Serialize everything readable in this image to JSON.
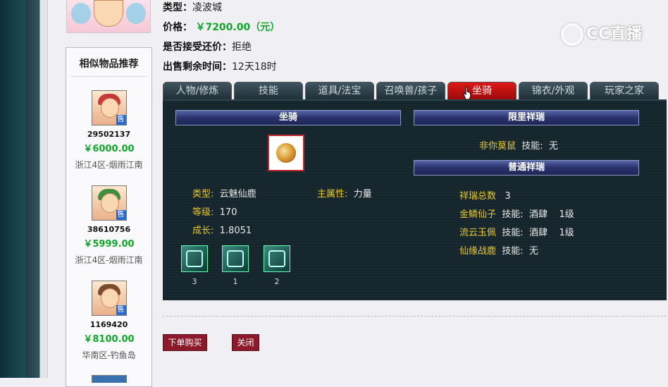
{
  "item": {
    "type_label": "类型：",
    "type_value": "凌波城",
    "price_label": "价格：",
    "price_value": "￥7200.00（元）",
    "bargain_label": "是否接受还价：",
    "bargain_value": "拒绝",
    "remaining_label": "出售剩余时间：",
    "remaining_value": "12天18时"
  },
  "watermark": "CC直播",
  "sidebar": {
    "title": "相似物品推荐",
    "sale_badge": "售",
    "items": [
      {
        "id": "29502137",
        "price": "￥6000.00",
        "server": "浙江4区-烟雨江南",
        "hair_color": "#c83a3a"
      },
      {
        "id": "38610756",
        "price": "￥5999.00",
        "server": "浙江4区-烟雨江南",
        "hair_color": "#3e8f3e"
      },
      {
        "id": "1169420",
        "price": "￥8100.00",
        "server": "华南区-钓鱼岛",
        "hair_color": "#7a4b2a"
      }
    ]
  },
  "tabs": [
    {
      "label": "人物/修炼",
      "active": false
    },
    {
      "label": "技能",
      "active": false
    },
    {
      "label": "道具/法宝",
      "active": false
    },
    {
      "label": "召唤兽/孩子",
      "active": false
    },
    {
      "label": "坐骑",
      "active": true
    },
    {
      "label": "锦衣/外观",
      "active": false
    },
    {
      "label": "玩家之家",
      "active": false
    }
  ],
  "mount": {
    "header": "坐骑",
    "type_label": "类型:",
    "type_value": "云魅仙鹿",
    "main_attr_label": "主属性:",
    "main_attr_value": "力量",
    "level_label": "等级:",
    "level_value": "170",
    "growth_label": "成长:",
    "growth_value": "1.8051",
    "skills": [
      "3",
      "1",
      "2"
    ]
  },
  "limited": {
    "header": "限里祥瑞",
    "name": "非你莫鼠",
    "skill_label": "技能:",
    "skill_value": "无"
  },
  "normal": {
    "header": "普通祥瑞",
    "total_label": "祥瑞总数",
    "total_value": "3",
    "items": [
      {
        "name": "金鳞仙子",
        "skill_label": "技能:",
        "skill": "酒肆",
        "level": "1级"
      },
      {
        "name": "流云玉佩",
        "skill_label": "技能:",
        "skill": "酒肆",
        "level": "1级"
      },
      {
        "name": "仙缘战鹿",
        "skill_label": "技能:",
        "skill": "无",
        "level": ""
      }
    ]
  },
  "actions": {
    "buy": "下单购买",
    "close": "关闭"
  }
}
